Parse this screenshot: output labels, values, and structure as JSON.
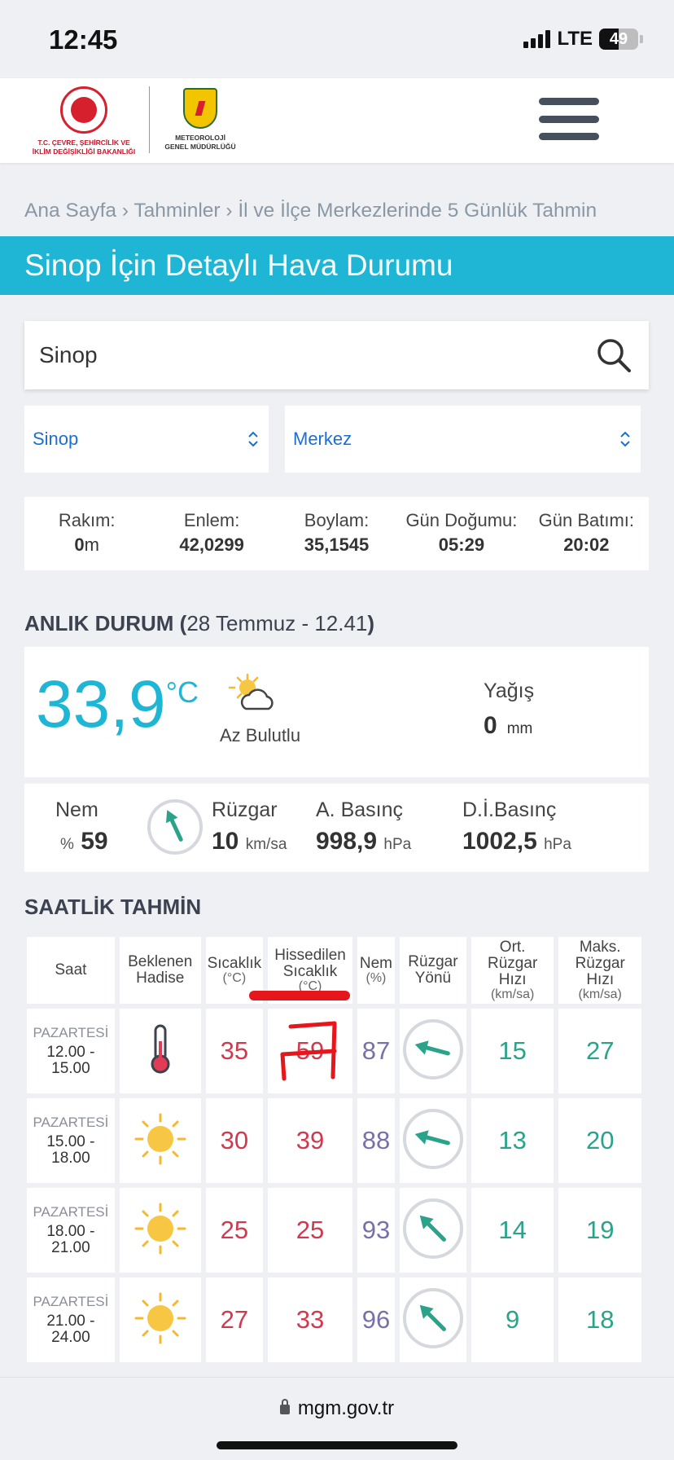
{
  "status": {
    "time": "12:45",
    "network": "LTE",
    "battery": "49",
    "battery_level": 0.49
  },
  "header": {
    "ministry_line1": "T.C. ÇEVRE, ŞEHİRCİLİK VE",
    "ministry_line2": "İKLİM DEĞİŞİKLİĞİ BAKANLIĞI",
    "mgm_line1": "METEOROLOJİ",
    "mgm_line2": "GENEL MÜDÜRLÜĞÜ"
  },
  "breadcrumb": "Ana Sayfa › Tahminler › İl ve İlçe Merkezlerinde 5 Günlük Tahmin",
  "title": {
    "city": "Sinop",
    "rest": " İçin Detaylı Hava Durumu"
  },
  "search": {
    "value": "Sinop"
  },
  "selects": {
    "il": "Sinop",
    "ilce": "Merkez"
  },
  "info": [
    {
      "label": "Rakım:",
      "value": "0",
      "unit": "m"
    },
    {
      "label": "Enlem:",
      "value": "42,0299",
      "unit": ""
    },
    {
      "label": "Boylam:",
      "value": "35,1545",
      "unit": ""
    },
    {
      "label": "Gün Doğumu:",
      "value": "05:29",
      "unit": ""
    },
    {
      "label": "Gün Batımı:",
      "value": "20:02",
      "unit": ""
    }
  ],
  "current": {
    "heading_bold": "ANLIK DURUM (",
    "heading_date": "28 Temmuz - 12.41",
    "heading_close": ")",
    "temperature": "33,9",
    "temp_unit": "°C",
    "condition": "Az Bulutlu",
    "precip_label": "Yağış",
    "precip_value": "0",
    "precip_unit": "mm",
    "humidity_label": "Nem",
    "humidity_prefix": "%",
    "humidity_value": "59",
    "wind_label": "Rüzgar",
    "wind_value": "10",
    "wind_unit": "km/sa",
    "pressure_label": "A. Basınç",
    "pressure_value": "998,9",
    "pressure_unit": "hPa",
    "sea_pressure_label": "D.İ.Basınç",
    "sea_pressure_value": "1002,5",
    "sea_pressure_unit": "hPa"
  },
  "hourly": {
    "heading": "SAATLİK TAHMİN",
    "headers": {
      "saat": "Saat",
      "hadise_1": "Beklenen",
      "hadise_2": "Hadise",
      "sicaklik": "Sıcaklık",
      "sicaklik_unit": "(°C)",
      "hissedilen_1": "Hissedilen",
      "hissedilen_2": "Sıcaklık",
      "hissedilen_unit": "(°C)",
      "nem": "Nem",
      "nem_unit": "(%)",
      "yon_1": "Rüzgar",
      "yon_2": "Yönü",
      "ort_1": "Ort.",
      "ort_2": "Rüzgar",
      "ort_3": "Hızı",
      "ort_unit": "(km/sa)",
      "maks_1": "Maks.",
      "maks_2": "Rüzgar",
      "maks_3": "Hızı",
      "maks_unit": "(km/sa)"
    },
    "rows": [
      {
        "day": "PAZARTESİ",
        "h1": "12.00 -",
        "h2": "15.00",
        "icon": "thermometer-icon",
        "temp": "35",
        "feels": "59",
        "humidity": "87",
        "wind_dir": "west-northwest",
        "avg": "15",
        "max": "27"
      },
      {
        "day": "PAZARTESİ",
        "h1": "15.00 -",
        "h2": "18.00",
        "icon": "sun-icon",
        "temp": "30",
        "feels": "39",
        "humidity": "88",
        "wind_dir": "west-northwest",
        "avg": "13",
        "max": "20"
      },
      {
        "day": "PAZARTESİ",
        "h1": "18.00 -",
        "h2": "21.00",
        "icon": "sun-icon",
        "temp": "25",
        "feels": "25",
        "humidity": "93",
        "wind_dir": "northwest",
        "avg": "14",
        "max": "19"
      },
      {
        "day": "PAZARTESİ",
        "h1": "21.00 -",
        "h2": "24.00",
        "icon": "sun-icon",
        "temp": "27",
        "feels": "33",
        "humidity": "96",
        "wind_dir": "northwest",
        "avg": "9",
        "max": "18"
      }
    ]
  },
  "urlbar": {
    "url": "mgm.gov.tr"
  },
  "colors": {
    "accent": "#1fb6d5",
    "temp_red": "#d0394e",
    "wind_green": "#2aa38a",
    "humidity_purple": "#7b6faa",
    "annotation_red": "#e5161c"
  }
}
